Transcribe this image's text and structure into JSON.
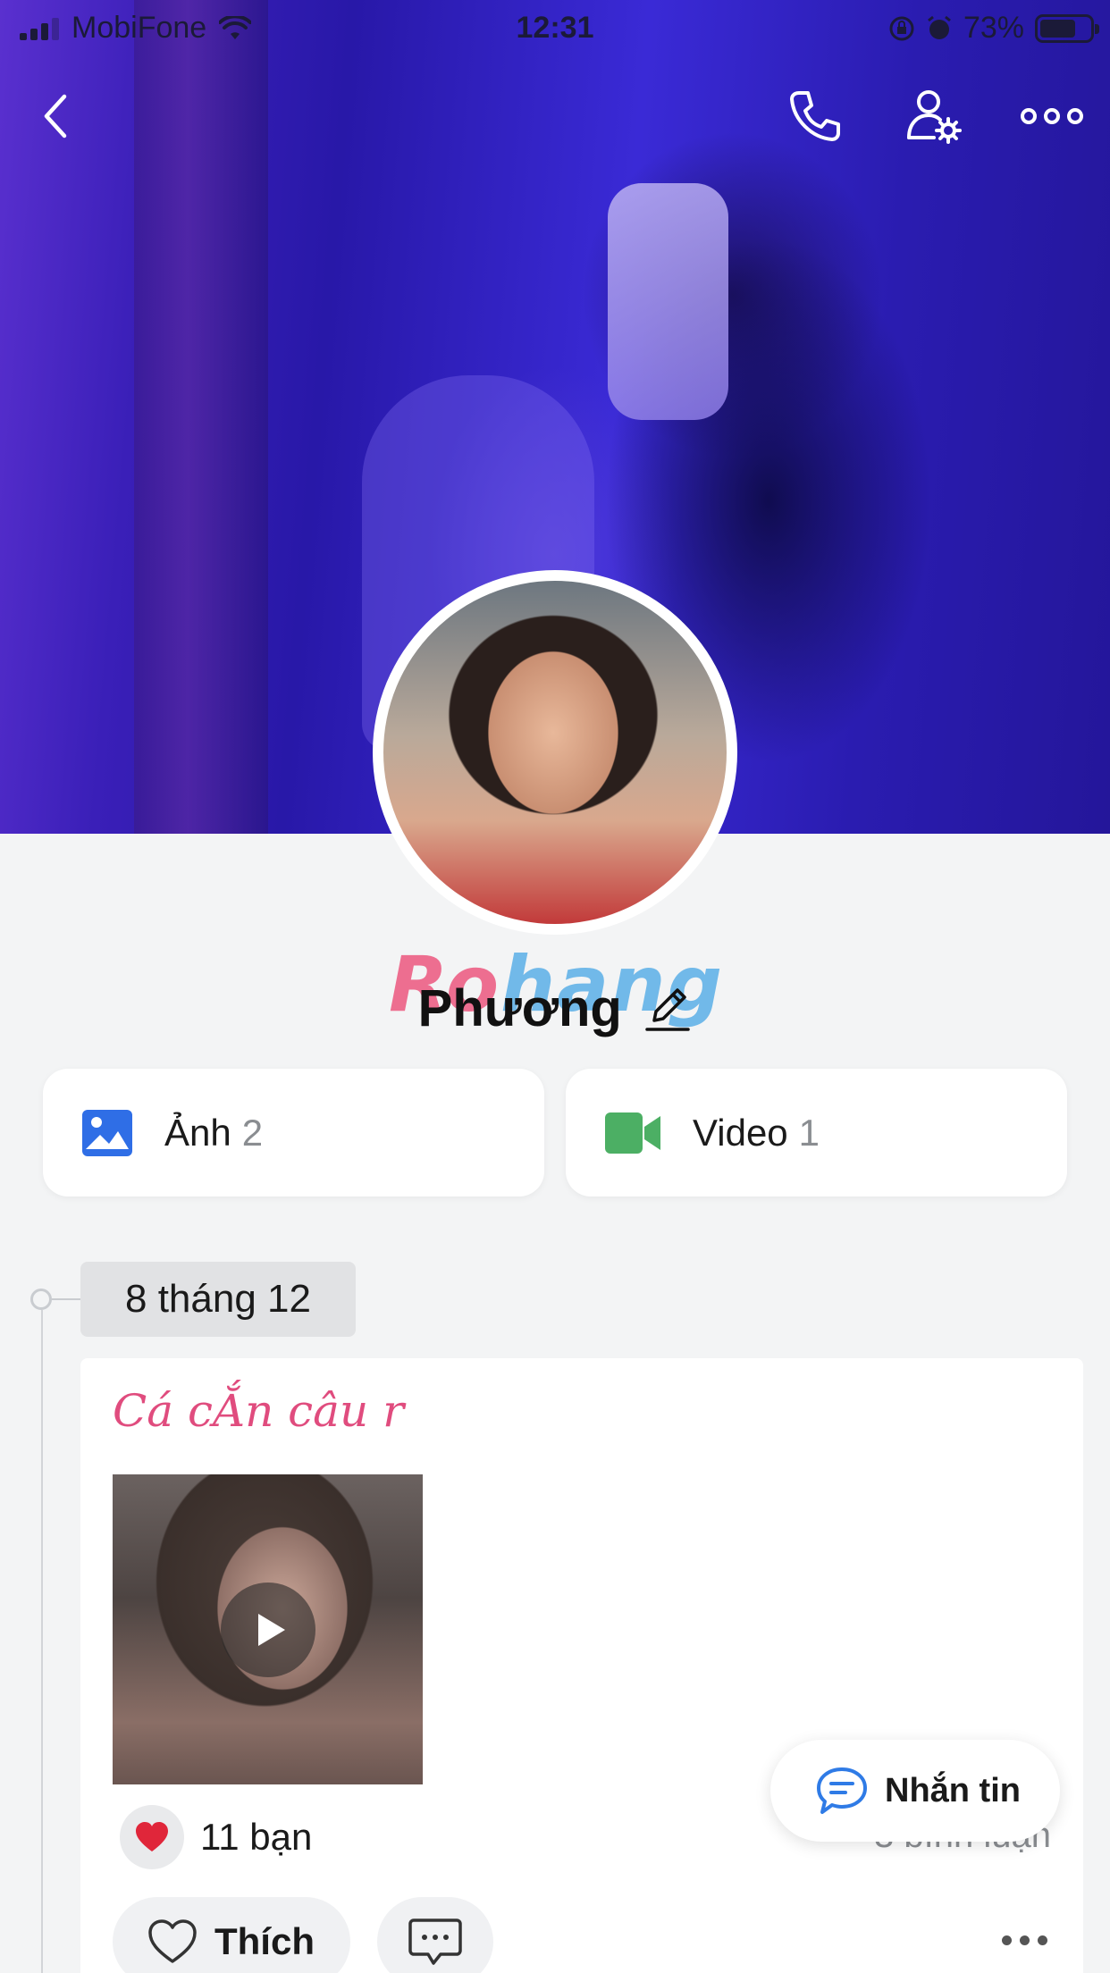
{
  "status_bar": {
    "carrier": "MobiFone",
    "time": "12:31",
    "battery_percent": "73%",
    "battery_level": 0.73
  },
  "nav": {
    "back_icon": "chevron-left-icon",
    "call_icon": "phone-icon",
    "settings_icon": "user-settings-icon",
    "more_icon": "more-horizontal-icon"
  },
  "profile": {
    "name": "Phương",
    "edit_icon": "pencil-icon"
  },
  "watermark": {
    "part1": "Ro",
    "part2": "hang"
  },
  "media": [
    {
      "label": "Ảnh",
      "count": "2",
      "icon": "photo-icon",
      "color": "#2f6ee6"
    },
    {
      "label": "Video",
      "count": "1",
      "icon": "video-camera-icon",
      "color": "#4caf64"
    }
  ],
  "timeline": {
    "date": "8 tháng 12"
  },
  "post": {
    "text": "Cá cẮn câu r",
    "reactions": "11 bạn",
    "comments": "3 bình luận",
    "like_label": "Thích"
  },
  "message_button": {
    "label": "Nhắn tin"
  },
  "colors": {
    "accent_blue": "#2f7be6",
    "post_text_pink": "#e04c7e",
    "heart_red": "#e0263a"
  }
}
